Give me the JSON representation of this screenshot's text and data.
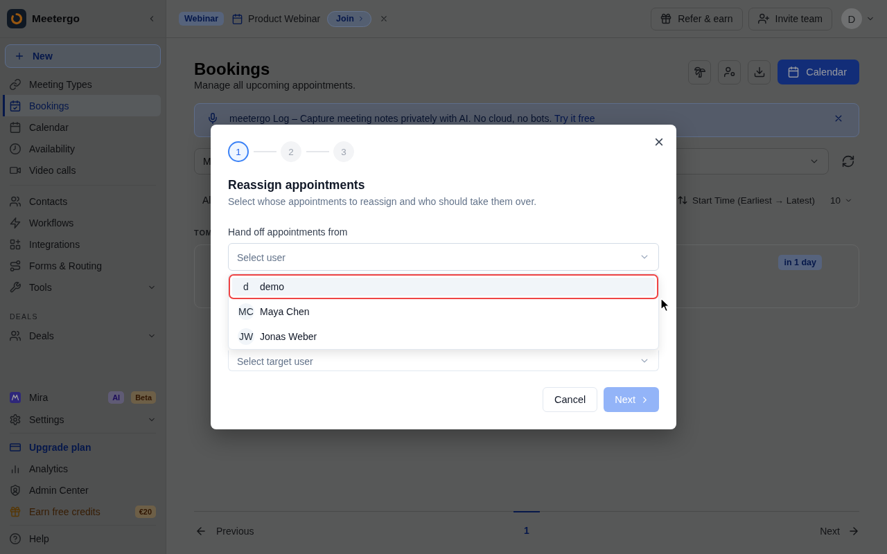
{
  "sidebar": {
    "brand": "Meetergo",
    "new_button": "New",
    "nav": [
      {
        "label": "Meeting Types",
        "kind": "link",
        "selected": false
      },
      {
        "label": "Bookings",
        "kind": "link",
        "selected": true
      },
      {
        "label": "Calendar",
        "kind": "link",
        "selected": false
      },
      {
        "label": "Availability",
        "kind": "link",
        "selected": false
      },
      {
        "label": "Video calls",
        "kind": "link",
        "selected": false
      }
    ],
    "nav_2": [
      {
        "label": "Contacts",
        "kind": "link",
        "selected": false
      },
      {
        "label": "Workflows",
        "kind": "link",
        "selected": false
      },
      {
        "label": "Integrations",
        "kind": "link",
        "selected": false
      },
      {
        "label": "Forms & Routing",
        "kind": "link",
        "selected": false
      },
      {
        "label": "Tools",
        "kind": "group",
        "selected": false
      }
    ],
    "deals": {
      "heading": "DEALS",
      "items": [
        {
          "label": "Deals",
          "kind": "group",
          "selected": false
        }
      ]
    },
    "bottom": [
      {
        "label": "Mira",
        "kind": "link",
        "selected": false,
        "badges": [
          {
            "label": "AI",
            "kind": "feature"
          },
          {
            "label": "Beta",
            "kind": "stage"
          }
        ]
      },
      {
        "label": "Settings",
        "kind": "group",
        "selected": false
      }
    ],
    "footer": [
      {
        "label": "Upgrade plan",
        "kind": "upsell",
        "selected": false
      },
      {
        "label": "Analytics",
        "kind": "link",
        "selected": false
      },
      {
        "label": "Admin Center",
        "kind": "link",
        "selected": false
      },
      {
        "label": "Earn free credits",
        "kind": "promo",
        "selected": false,
        "badges": [
          {
            "label": "€20",
            "kind": "reward"
          }
        ]
      }
    ],
    "help": {
      "label": "Help",
      "kind": "link",
      "selected": false
    }
  },
  "top_bar": {
    "event": {
      "badge": "Webinar",
      "title": "Product Webinar",
      "join": "Join"
    },
    "actions": [
      "Refer & earn",
      "Invite team"
    ],
    "avatar": "D"
  },
  "page": {
    "title": "Bookings",
    "subtitle": "Manage all upcoming appointments.",
    "calendar_button": "Calendar",
    "banner": {
      "text": "meetergo Log – Capture meeting notes privately with AI. No cloud, no bots.",
      "link": "Try it free"
    },
    "filter": {
      "value": "M"
    },
    "tab": "Al",
    "sort": "Start Time (Earliest → Latest)",
    "page_size": "10",
    "section": "TOM",
    "booking": {
      "badge": "in 1 day"
    },
    "pagination": {
      "previous": "Previous",
      "pages": [
        {
          "label": "1",
          "selected": true
        }
      ],
      "next": "Next"
    }
  },
  "modal": {
    "steps": [
      {
        "label": "1",
        "active": true
      },
      {
        "label": "2",
        "active": false
      },
      {
        "label": "3",
        "active": false
      }
    ],
    "title": "Reassign appointments",
    "description": "Select whose appointments to reassign and who should take them over.",
    "from_field": {
      "label": "Hand off appointments from",
      "placeholder": "Select user",
      "expanded": true,
      "options": [
        {
          "initials": "d",
          "name": "demo",
          "highlighted": true
        },
        {
          "initials": "MC",
          "name": "Maya Chen",
          "highlighted": false
        },
        {
          "initials": "JW",
          "name": "Jonas Weber",
          "highlighted": false
        }
      ]
    },
    "to_field": {
      "placeholder": "Select target user"
    },
    "buttons": [
      {
        "label": "Cancel",
        "kind": "secondary",
        "disabled": false
      },
      {
        "label": "Next",
        "kind": "primary",
        "disabled": true
      }
    ]
  }
}
